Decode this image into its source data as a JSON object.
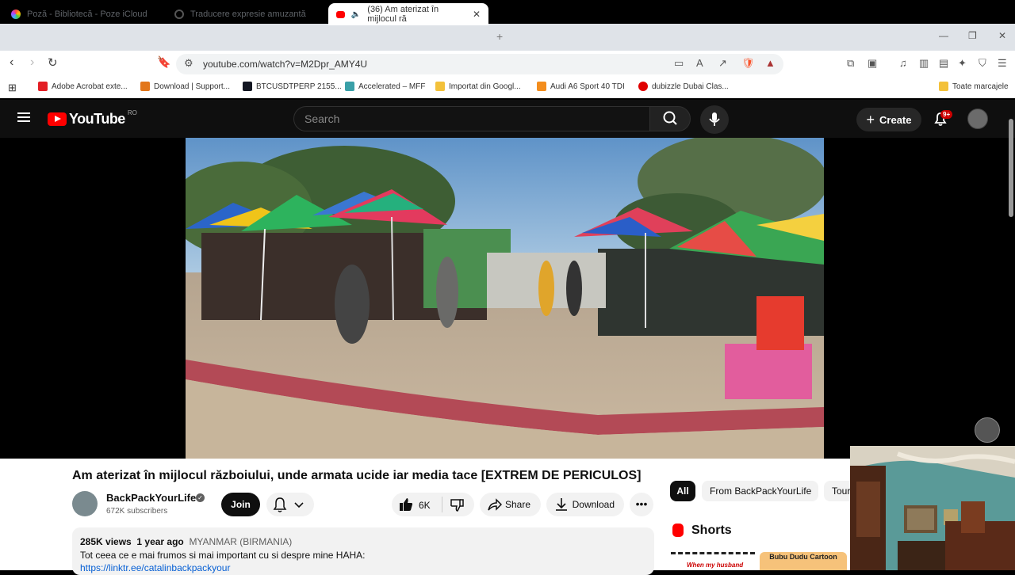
{
  "browser": {
    "tabs": [
      {
        "title": "Poză - Bibliotecă - Poze iCloud",
        "active": false
      },
      {
        "title": "Traducere expresie amuzantă",
        "active": false
      },
      {
        "title": "(36) Am aterizat în mijlocul ră",
        "active": true
      }
    ],
    "url": "youtube.com/watch?v=M2Dpr_AMY4U",
    "bookmarks": [
      {
        "label": "Adobe Acrobat exte...",
        "icon_color": "#e31e24"
      },
      {
        "label": "Download | Support...",
        "icon_color": "#e2761b"
      },
      {
        "label": "BTCUSDTPERP 2155...",
        "icon_color": "#131722"
      },
      {
        "label": "Accelerated – MFF",
        "icon_color": "#3aa0a8"
      },
      {
        "label": "Importat din Googl...",
        "icon_color": "#f3c13a"
      },
      {
        "label": "Audi A6 Sport 40 TDI",
        "icon_color": "#f38d1d"
      },
      {
        "label": "dubizzle Dubai Clas...",
        "icon_color": "#e00000"
      }
    ],
    "all_bookmarks": "Toate marcajele"
  },
  "youtube": {
    "logo_text": "YouTube",
    "region": "RO",
    "search_placeholder": "Search",
    "create_label": "Create",
    "notifications_badge": "9+"
  },
  "video": {
    "title": "Am aterizat în mijlocul războiului, unde armata ucide iar media tace [EXTREM DE PERICULOS]",
    "channel": "BackPackYourLife",
    "subscribers": "672K subscribers",
    "join_label": "Join",
    "likes": "6K",
    "share_label": "Share",
    "download_label": "Download",
    "views": "285K views",
    "age": "1 year ago",
    "location": "MYANMAR (BIRMANIA)",
    "description_line": "Tot ceea ce e mai frumos si mai important cu si despre mine HAHA:",
    "description_link": "https://linktr.ee/catalinbackpackyour"
  },
  "sidebar": {
    "chips": [
      "All",
      "From BackPackYourLife",
      "Tour"
    ],
    "shorts_title": "Shorts",
    "short_captions": [
      "When my husband",
      "Bubu Dudu Cartoon"
    ]
  }
}
